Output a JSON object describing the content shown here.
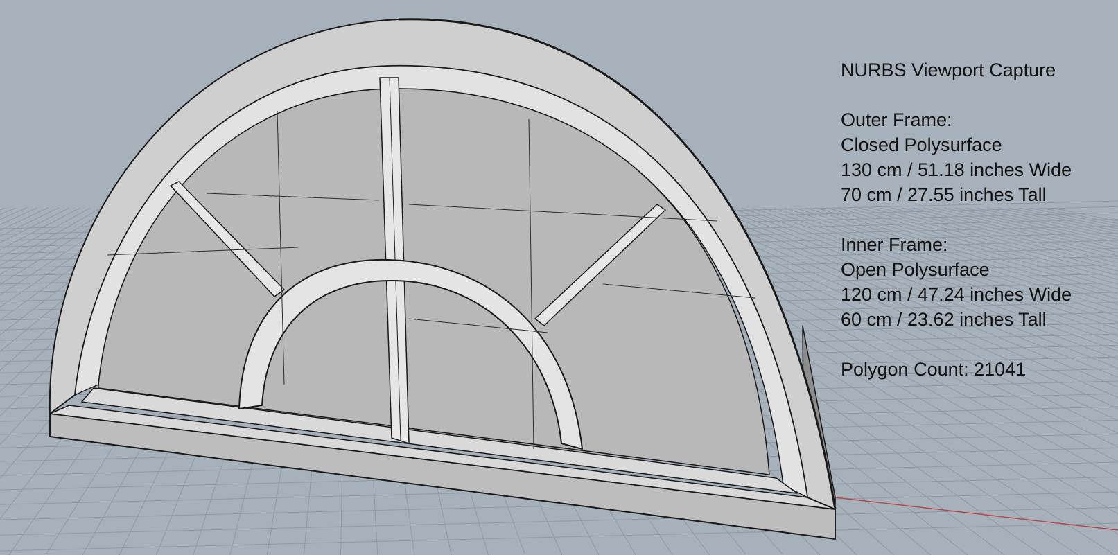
{
  "viewport": {
    "background_color": "#a7b1bb",
    "grid_color": "#8f99a3",
    "axis_color": "#b44a4a",
    "model_fill": "#c7c7c7",
    "glass_fill": "#b9b9b9",
    "edge_color": "#1a1a1a"
  },
  "info": {
    "title": "NURBS Viewport Capture",
    "outer_frame": {
      "heading": "Outer Frame:",
      "type": "Closed Polysurface",
      "width": "130 cm / 51.18 inches Wide",
      "height": "70 cm / 27.55 inches Tall"
    },
    "inner_frame": {
      "heading": "Inner Frame:",
      "type": "Open Polysurface",
      "width": "120 cm / 47.24 inches Wide",
      "height": "60 cm / 23.62 inches Tall"
    },
    "polygon_count": "Polygon Count: 21041"
  }
}
